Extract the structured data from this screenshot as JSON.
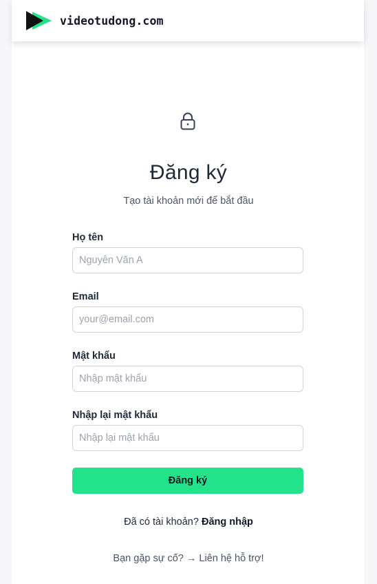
{
  "header": {
    "brand": "videotudong.com",
    "logo_icon": "play-logo-icon",
    "colors": {
      "logo_dark": "#111111",
      "logo_accent": "#22e38a"
    }
  },
  "auth": {
    "icon": "lock-icon",
    "title": "Đăng ký",
    "subtitle": "Tạo tài khoản mới để bắt đầu"
  },
  "form": {
    "fields": [
      {
        "label": "Họ tên",
        "placeholder": "Nguyễn Văn A",
        "value": ""
      },
      {
        "label": "Email",
        "placeholder": "your@email.com",
        "value": ""
      },
      {
        "label": "Mật khẩu",
        "placeholder": "Nhập mật khẩu",
        "value": ""
      },
      {
        "label": "Nhập lại mật khẩu",
        "placeholder": "Nhập lại mật khẩu",
        "value": ""
      }
    ],
    "submit_label": "Đăng ký",
    "submit_color": "#22e38a"
  },
  "footer": {
    "login_prompt": "Đã có tài khoản?",
    "login_link": "Đăng nhập",
    "support_prompt": "Bạn gặp sự cố?",
    "support_link": "Liên hệ hỗ trợ!"
  }
}
